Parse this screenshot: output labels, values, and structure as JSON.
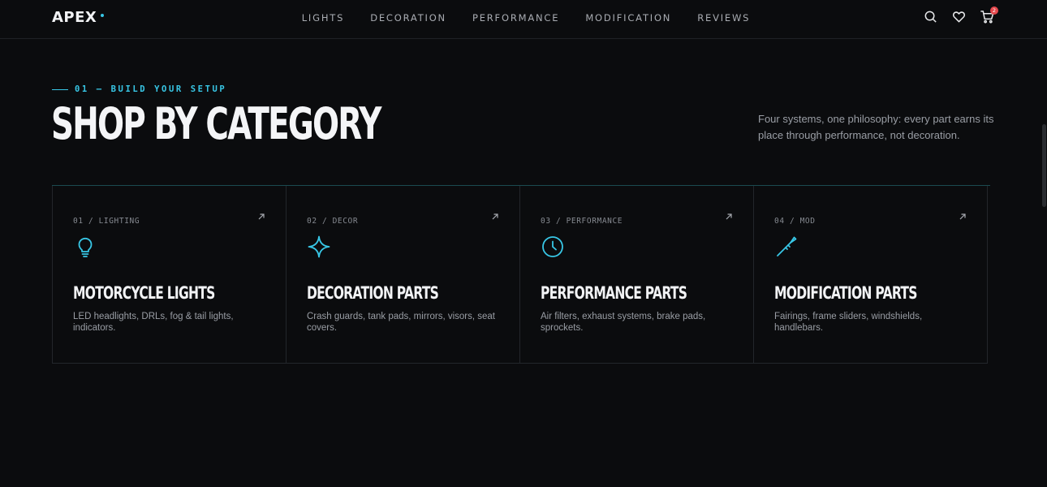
{
  "nav": {
    "logo": "APEX",
    "menu": [
      "LIGHTS",
      "DECORATION",
      "PERFORMANCE",
      "MODIFICATION",
      "REVIEWS"
    ],
    "icons": [
      "search-icon",
      "heart-icon",
      "cart-icon"
    ],
    "cart_count": "2"
  },
  "section": {
    "eyebrow": "01 — BUILD YOUR SETUP",
    "title": "SHOP BY CATEGORY",
    "intro": "Four systems, one philosophy: every part earns its place through performance, not decoration."
  },
  "cards": [
    {
      "kicker": "01 / LIGHTING",
      "icon": "lightbulb-icon",
      "title": "MOTORCYCLE LIGHTS",
      "desc": "LED headlights, DRLs, fog & tail lights, indicators."
    },
    {
      "kicker": "02 / DECOR",
      "icon": "sparkle-icon",
      "title": "DECORATION PARTS",
      "desc": "Crash guards, tank pads, mirrors, visors, seat covers."
    },
    {
      "kicker": "03 / PERFORMANCE",
      "icon": "clock-icon",
      "title": "PERFORMANCE PARTS",
      "desc": "Air filters, exhaust systems, brake pads, sprockets."
    },
    {
      "kicker": "04 / MOD",
      "icon": "wand-icon",
      "title": "MODIFICATION PARTS",
      "desc": "Fairings, frame sliders, windshields, handlebars."
    }
  ],
  "colors": {
    "accent": "#38c7e6",
    "background": "#0b0c0e",
    "badge": "#e5484d"
  }
}
